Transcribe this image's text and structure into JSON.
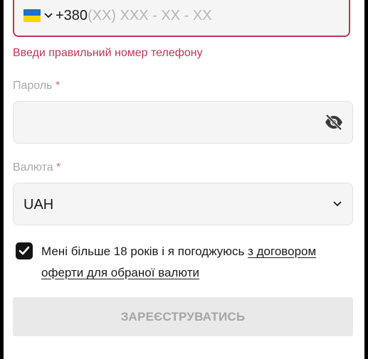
{
  "phone": {
    "country_flag": "ukraine-flag",
    "prefix": "+380",
    "mask_placeholder": "(XX) XXX - XX - XX",
    "error": "Введи правильний номер телефону",
    "error_color": "#c03455"
  },
  "password": {
    "label": "Пароль",
    "required_mark": "*",
    "value": "",
    "visibility_icon": "eye-slash-icon"
  },
  "currency": {
    "label": "Валюта",
    "required_mark": "*",
    "selected": "UAH"
  },
  "agreement": {
    "checked": true,
    "text": "Мені більше 18 років і я погоджуюсь ",
    "link": "з договором оферти для обраної валюти"
  },
  "submit": {
    "label": "ЗАРЕЄСТРУВАТИСЬ",
    "disabled": true
  }
}
